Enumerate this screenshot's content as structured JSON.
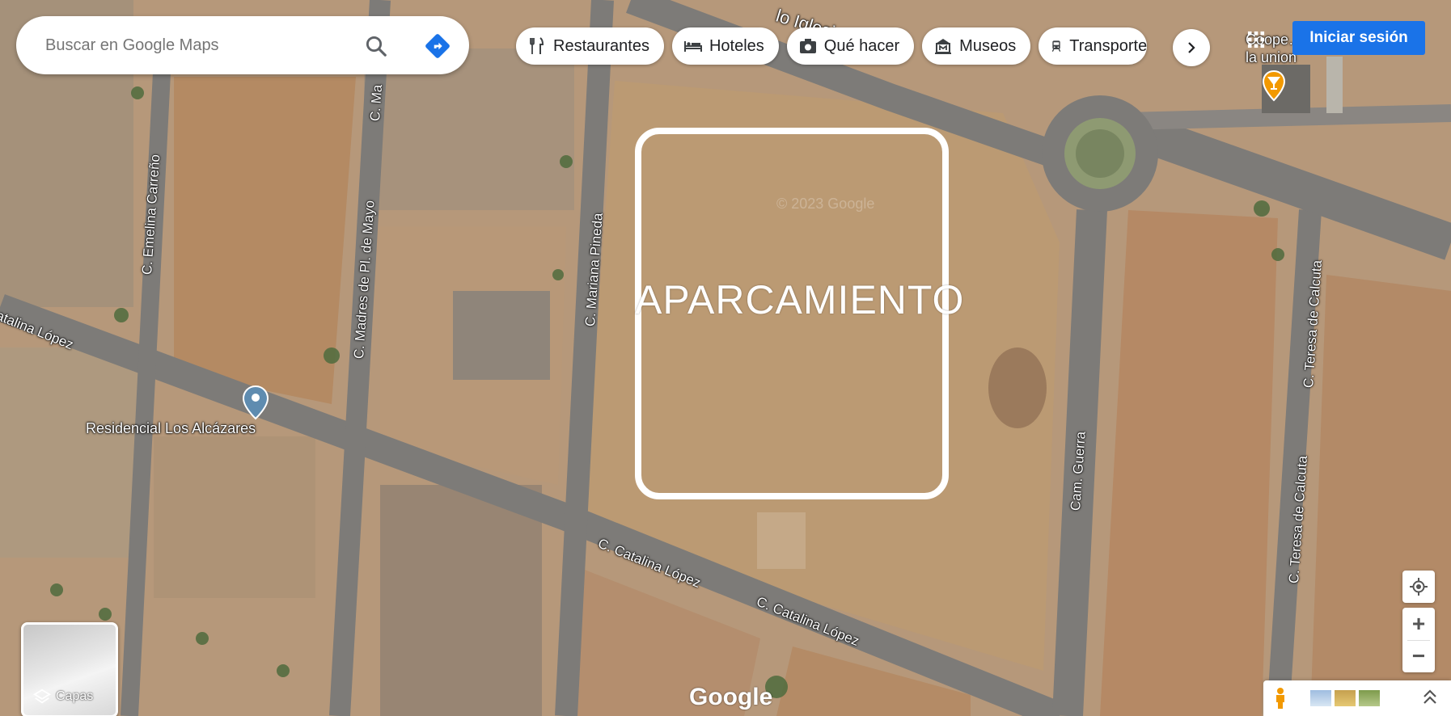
{
  "search": {
    "placeholder": "Buscar en Google Maps"
  },
  "chips": [
    {
      "label": "Restaurantes",
      "icon": "restaurant-icon"
    },
    {
      "label": "Hoteles",
      "icon": "hotel-icon"
    },
    {
      "label": "Qué hacer",
      "icon": "camera-icon"
    },
    {
      "label": "Museos",
      "icon": "museum-icon"
    },
    {
      "label": "Transporte",
      "icon": "transit-icon"
    }
  ],
  "header": {
    "signin_label": "Iniciar sesión",
    "poi_top_right": "Coope… agricola la union"
  },
  "map": {
    "annotation_label": "APARCAMIENTO",
    "watermark": "© 2023 Google",
    "poi_residencial": "Residencial Los Alcázares",
    "streets": {
      "emelina": "C. Emelina Carreño",
      "madres": "C. Madres de Pl. de Mayo",
      "ma_top": "C. Ma",
      "mariana": "C. Mariana Pineda",
      "catalina_left": "atalina López",
      "catalina_mid": "C. Catalina López",
      "catalina_right": "C. Catalina López",
      "guerra": "Cam. Guerra",
      "teresa_top": "C. Teresa de Calcuta",
      "teresa_bottom": "C. Teresa de Calcuta",
      "iglesias": "lo Iglesias"
    }
  },
  "controls": {
    "zoom_in": "+",
    "zoom_out": "−",
    "layers_label": "Capas",
    "google_logo": "Google"
  },
  "colors": {
    "accent": "#1a73e8",
    "directions": "#1a73e8",
    "pin": "#5f8cb0",
    "poi_orange": "#f29900"
  }
}
